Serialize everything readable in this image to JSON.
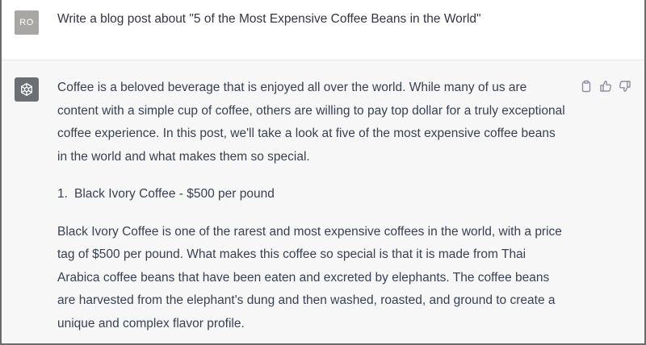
{
  "user": {
    "avatar_initials": "RO",
    "prompt": "Write a blog post about \"5 of the Most Expensive Coffee Beans in the World\""
  },
  "assistant": {
    "avatar_icon": "openai-logo-icon",
    "intro": "Coffee is a beloved beverage that is enjoyed all over the world. While many of us are content with a simple cup of coffee, others are willing to pay top dollar for a truly exceptional coffee experience. In this post, we'll take a look at five of the most expensive coffee beans in the world and what makes them so special.",
    "list": [
      {
        "number": "1.",
        "text": "Black Ivory Coffee - $500 per pound"
      }
    ],
    "body": "Black Ivory Coffee is one of the rarest and most expensive coffees in the world, with a price tag of $500 per pound. What makes this coffee so special is that it is made from Thai Arabica coffee beans that have been eaten and excreted by elephants. The coffee beans are harvested from the elephant's dung and then washed, roasted, and ground to create a unique and complex flavor profile."
  },
  "actions": {
    "copy_icon": "clipboard-icon",
    "like_icon": "thumbs-up-icon",
    "dislike_icon": "thumbs-down-icon"
  }
}
